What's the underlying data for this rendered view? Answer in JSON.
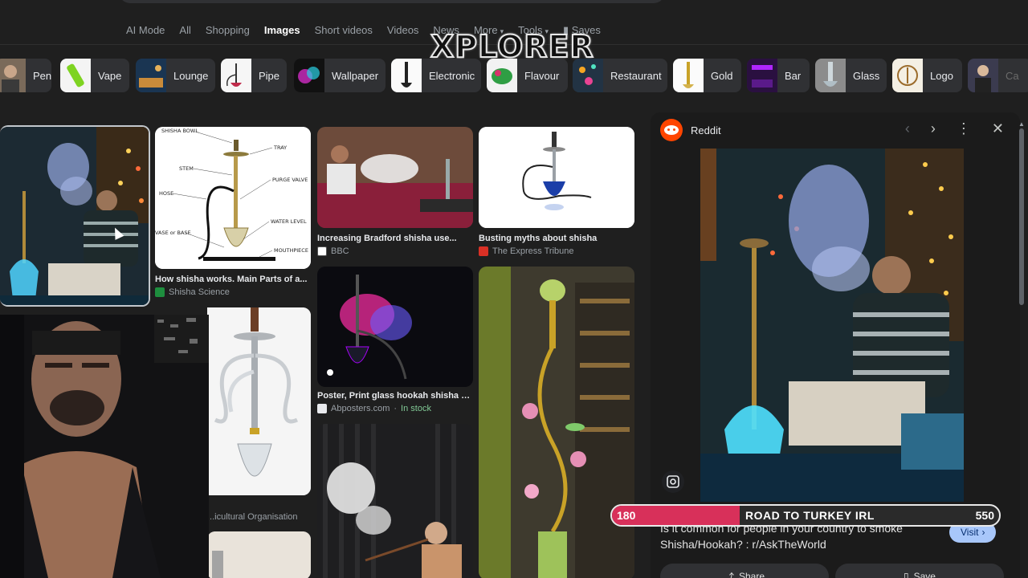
{
  "nav": {
    "tabs": [
      {
        "label": "AI Mode"
      },
      {
        "label": "All"
      },
      {
        "label": "Shopping"
      },
      {
        "label": "Images"
      },
      {
        "label": "Short videos"
      },
      {
        "label": "Videos"
      },
      {
        "label": "News"
      },
      {
        "label": "More"
      },
      {
        "label": "Tools"
      },
      {
        "label": "Saves"
      }
    ]
  },
  "overlay_logo": "XPLORER",
  "chips": [
    {
      "label": "Pen"
    },
    {
      "label": "Vape"
    },
    {
      "label": "Lounge"
    },
    {
      "label": "Pipe"
    },
    {
      "label": "Wallpaper"
    },
    {
      "label": "Electronic"
    },
    {
      "label": "Flavour"
    },
    {
      "label": "Restaurant"
    },
    {
      "label": "Gold"
    },
    {
      "label": "Bar"
    },
    {
      "label": "Glass"
    },
    {
      "label": "Logo"
    },
    {
      "label": "Ca"
    }
  ],
  "results": [
    {
      "caption": "How shisha works. Main Parts of a...",
      "source": "Shisha Science"
    },
    {
      "caption": "Increasing Bradford shisha use...",
      "source": "BBC"
    },
    {
      "caption": "Busting myths about shisha",
      "source": "The Express Tribune"
    },
    {
      "caption": "Poster, Print glass hookah shisha with a...",
      "source": "Abposters.com",
      "stock": "In stock"
    },
    {
      "source": "...icultural Organisation"
    }
  ],
  "diagram_labels": {
    "bowl": "SHISHA BOWL",
    "tray": "TRAY",
    "stem": "STEM",
    "purge": "PURGE VALVE",
    "hose": "HOSE",
    "water": "WATER LEVEL",
    "base": "VASE or BASE",
    "mouth": "MOUTHPIECE"
  },
  "panel": {
    "site": "Reddit",
    "title": "Is it common for people in your country to smoke Shisha/Hookah? : r/AskTheWorld",
    "visit_label": "Visit",
    "share_label": "Share",
    "save_label": "Save"
  },
  "stream_bar": {
    "title": "ROAD TO TURKEY IRL",
    "start": "180",
    "end": "550",
    "progress": 0.33
  },
  "colors": {
    "background": "#1f1f1f",
    "reddit": "#ff4500",
    "visit_button": "#a8c7fa",
    "progress_fill": "#d8305a"
  }
}
